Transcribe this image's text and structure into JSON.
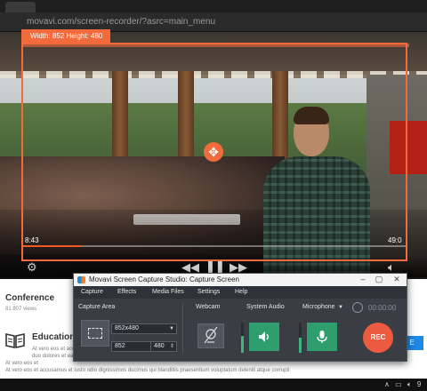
{
  "browser": {
    "url": "movavi.com/screen-recorder/?asrc=main_menu"
  },
  "video": {
    "time_elapsed": "8:43",
    "time_total": "49:0",
    "progress": 0.15
  },
  "capture_overlay": {
    "size_label": "Width: 852  Height: 480"
  },
  "page": {
    "conference_title": "Conference",
    "conference_views": "81 807 views",
    "education_title": "Education",
    "education_lines": [
      "At vero eos et accusam et justo duo dolores et ea rebum",
      "duo dolores et ea",
      "At vero eos et",
      "At vero eos et accusamus et iusto odio dignissimos ducimus qui blanditiis praesentium voluptatum deleniti atque corrupti"
    ],
    "button_label": "E"
  },
  "recorder": {
    "title": "Movavi Screen Capture Studio: Capture Screen",
    "menu": [
      "Capture",
      "Effects",
      "Media Files",
      "Settings",
      "Help"
    ],
    "capture_area_label": "Capture Area",
    "preset_value": "852x480",
    "width_value": "852",
    "height_value": "480",
    "times_symbol": "×",
    "webcam_label": "Webcam",
    "system_audio_label": "System Audio",
    "microphone_label": "Microphone",
    "system_audio_level": 0.55,
    "microphone_level": 0.5,
    "timer": "00:00:00",
    "rec_label": "REC",
    "colors": {
      "accent_orange": "#ec5a3f",
      "audio_green": "#2e9e6f",
      "panel": "#3a3d44"
    }
  }
}
